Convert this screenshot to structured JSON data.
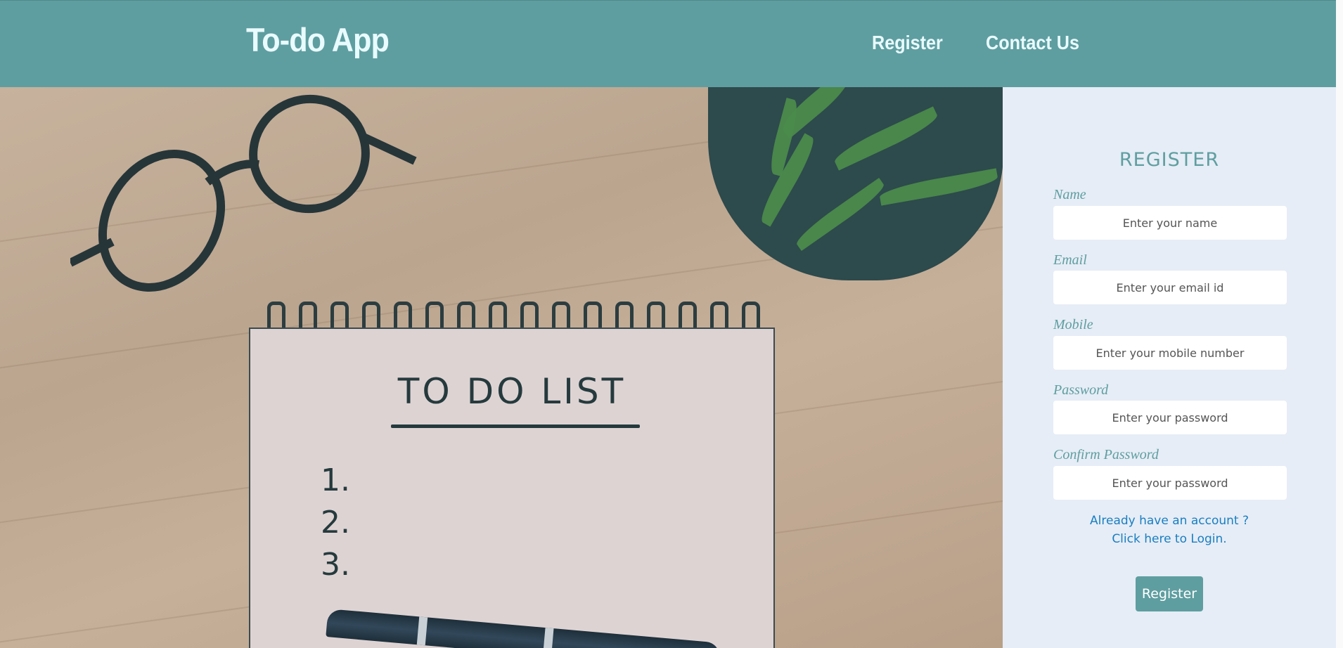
{
  "header": {
    "brand": "To-do App",
    "nav": [
      {
        "label": "Register"
      },
      {
        "label": "Contact Us"
      }
    ]
  },
  "hero": {
    "notebook_title": "TO DO LIST",
    "list_numbers": [
      "1.",
      "2.",
      "3."
    ]
  },
  "register": {
    "title": "REGISTER",
    "fields": [
      {
        "label": "Name",
        "placeholder": "Enter your name"
      },
      {
        "label": "Email",
        "placeholder": "Enter your email id"
      },
      {
        "label": "Mobile",
        "placeholder": "Enter your mobile number"
      },
      {
        "label": "Password",
        "placeholder": "Enter your password"
      },
      {
        "label": "Confirm Password",
        "placeholder": "Enter your password"
      }
    ],
    "login_line1": "Already have an account ?",
    "login_line2": "Click here to Login.",
    "button_label": "Register"
  },
  "colors": {
    "header_bg": "#5f9ea0",
    "panel_bg": "#e6edf6",
    "accent": "#5f9ea0",
    "link": "#1a7ec2"
  }
}
